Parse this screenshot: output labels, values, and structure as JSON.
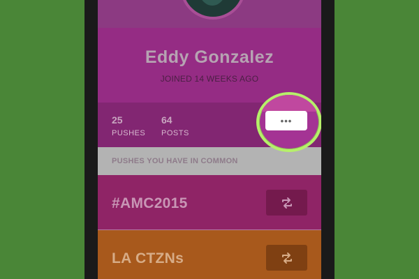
{
  "profile": {
    "name": "Eddy Gonzalez",
    "joined": "JOINED 14 WEEKS AGO"
  },
  "stats": {
    "pushes": {
      "value": "25",
      "label": "PUSHES"
    },
    "posts": {
      "value": "64",
      "label": "POSTS"
    }
  },
  "more_button": {
    "label": "•••"
  },
  "common": {
    "header": "PUSHES YOU HAVE IN COMMON",
    "items": [
      {
        "title": "#AMC2015",
        "icon": "repush-icon"
      },
      {
        "title": "LA CTZNs",
        "icon": "repush-icon"
      }
    ]
  },
  "colors": {
    "background": "#4a8637",
    "highlight_ring": "#b6f06a",
    "profile_bg": "#952c84",
    "row1_bg": "#8f2466",
    "row2_bg": "#a8591c"
  }
}
